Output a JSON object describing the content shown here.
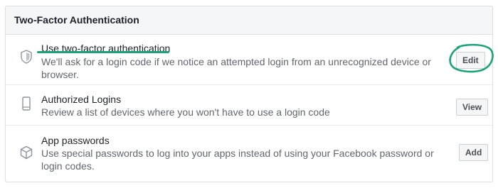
{
  "header": {
    "title": "Two-Factor Authentication"
  },
  "rows": [
    {
      "icon": "shield-icon",
      "title": "Use two-factor authentication",
      "description": "We'll ask for a login code if we notice an attempted login from an unrecognized device or browser.",
      "button": "Edit"
    },
    {
      "icon": "phone-icon",
      "title": "Authorized Logins",
      "description": "Review a list of devices where you won't have to use a login code",
      "button": "View"
    },
    {
      "icon": "cube-icon",
      "title": "App passwords",
      "description": "Use special passwords to log into your apps instead of using your Facebook password or login codes.",
      "button": "Add"
    }
  ],
  "colors": {
    "annotation": "#1aa37a",
    "header_bg": "#f5f6f7",
    "border": "#dddfe2"
  }
}
